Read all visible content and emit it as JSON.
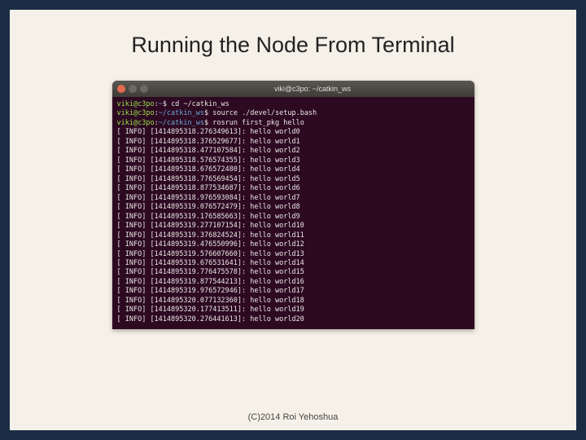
{
  "slide": {
    "title": "Running the Node From Terminal",
    "footer": "(C)2014 Roi Yehoshua"
  },
  "terminal": {
    "window_title": "viki@c3po: ~/catkin_ws",
    "prompts": [
      {
        "user": "viki@c3po",
        "path": "~",
        "cmd": "cd ~/catkin_ws"
      },
      {
        "user": "viki@c3po",
        "path": "~/catkin_ws",
        "cmd": "source ./devel/setup.bash"
      },
      {
        "user": "viki@c3po",
        "path": "~/catkin_ws",
        "cmd": "rosrun first_pkg hello"
      }
    ],
    "logs": [
      {
        "level": "INFO",
        "ts": "1414895318.276349613",
        "msg": "hello world0"
      },
      {
        "level": "INFO",
        "ts": "1414895318.376529677",
        "msg": "hello world1"
      },
      {
        "level": "INFO",
        "ts": "1414895318.477107584",
        "msg": "hello world2"
      },
      {
        "level": "INFO",
        "ts": "1414895318.576574355",
        "msg": "hello world3"
      },
      {
        "level": "INFO",
        "ts": "1414895318.676572480",
        "msg": "hello world4"
      },
      {
        "level": "INFO",
        "ts": "1414895318.776569454",
        "msg": "hello world5"
      },
      {
        "level": "INFO",
        "ts": "1414895318.877534687",
        "msg": "hello world6"
      },
      {
        "level": "INFO",
        "ts": "1414895318.976593084",
        "msg": "hello world7"
      },
      {
        "level": "INFO",
        "ts": "1414895319.076572479",
        "msg": "hello world8"
      },
      {
        "level": "INFO",
        "ts": "1414895319.176585663",
        "msg": "hello world9"
      },
      {
        "level": "INFO",
        "ts": "1414895319.277107154",
        "msg": "hello world10"
      },
      {
        "level": "INFO",
        "ts": "1414895319.376824524",
        "msg": "hello world11"
      },
      {
        "level": "INFO",
        "ts": "1414895319.476550996",
        "msg": "hello world12"
      },
      {
        "level": "INFO",
        "ts": "1414895319.576607660",
        "msg": "hello world13"
      },
      {
        "level": "INFO",
        "ts": "1414895319.676531641",
        "msg": "hello world14"
      },
      {
        "level": "INFO",
        "ts": "1414895319.776475578",
        "msg": "hello world15"
      },
      {
        "level": "INFO",
        "ts": "1414895319.877544213",
        "msg": "hello world16"
      },
      {
        "level": "INFO",
        "ts": "1414895319.976572946",
        "msg": "hello world17"
      },
      {
        "level": "INFO",
        "ts": "1414895320.077132360",
        "msg": "hello world18"
      },
      {
        "level": "INFO",
        "ts": "1414895320.177413511",
        "msg": "hello world19"
      },
      {
        "level": "INFO",
        "ts": "1414895320.276441613",
        "msg": "hello world20"
      }
    ]
  }
}
